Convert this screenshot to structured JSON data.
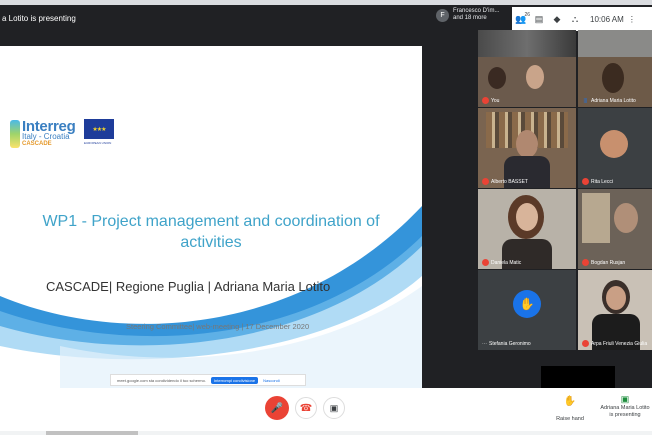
{
  "top": {
    "presenting_text": "a Lotito is presenting",
    "participants_avatar": "F",
    "participants_name": "Francesco D'im...",
    "participants_more": "and 18 more",
    "people_count": "26",
    "time": "10:06 AM",
    "icons": [
      "people-icon",
      "chat-icon",
      "activities-icon",
      "shield-icon"
    ]
  },
  "slide": {
    "logo_main": "Interreg",
    "logo_sub": "Italy - Croatia",
    "logo_project": "CASCADE",
    "eu_text": "EUROPEAN UNION",
    "title": "WP1 - Project management and coordination of activities",
    "subtitle": "CASCADE| Regione Puglia | Adriana Maria Lotito",
    "meta": "Steering Committee| web-meeting | 17 December 2020",
    "share_text": "meet.google.com sta condividendo il tuo schermo.",
    "share_stop": "Interrompi condivisione",
    "share_hide": "Nascondi"
  },
  "participants": [
    {
      "name": "You",
      "muted": true
    },
    {
      "name": "Adriana Maria Lotito",
      "muted": false
    },
    {
      "name": "Alberto BASSET",
      "muted": true
    },
    {
      "name": "Rita Lecci",
      "muted": true
    },
    {
      "name": "Daniela Matic",
      "muted": true
    },
    {
      "name": "Bogdan Rusjan",
      "muted": true
    },
    {
      "name": "Stefania Geronimo",
      "muted": false
    },
    {
      "name": "Arpa Friuli Venezia Giulia",
      "muted": true
    }
  ],
  "bottom": {
    "raise_hand": "Raise hand",
    "presenter_line1": "Adriana Maria Lotito",
    "presenter_line2": "is presenting"
  },
  "colors": {
    "mute_red": "#ea4335",
    "slide_title": "#3fa3c9",
    "accent_blue": "#1a73e8"
  }
}
